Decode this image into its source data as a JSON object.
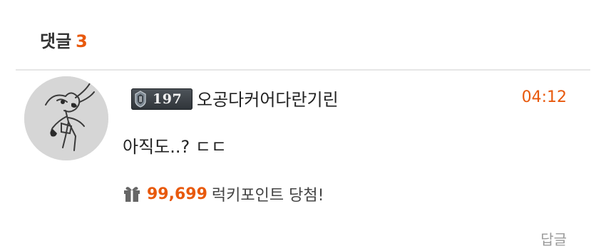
{
  "section": {
    "title": "댓글",
    "count": "3"
  },
  "comment": {
    "level": "197",
    "username": "오공다커어다란기린",
    "timestamp": "04:12",
    "text": "아직도..? ㄷㄷ",
    "lucky_points": "99,699",
    "lucky_label": "럭키포인트 당첨!",
    "reply_label": "답글"
  },
  "colors": {
    "accent": "#e8590c",
    "divider": "#e6e6e6",
    "muted": "#9a9a9a"
  },
  "icons": {
    "level_emblem": "level-emblem-icon",
    "gift": "gift-icon"
  }
}
